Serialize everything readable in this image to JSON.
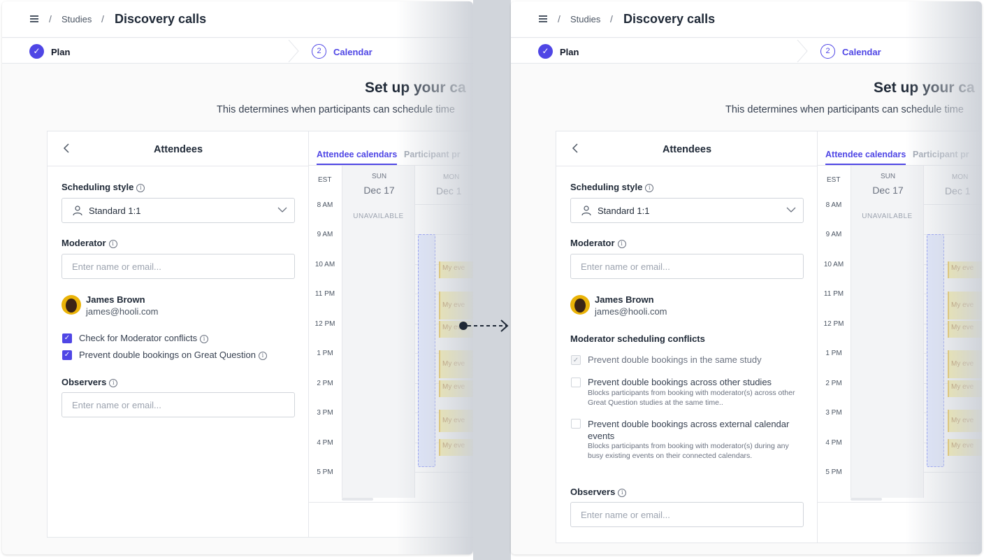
{
  "breadcrumb": {
    "separator": "/",
    "studies": "Studies",
    "title": "Discovery calls"
  },
  "stepper": {
    "step1_label": "Plan",
    "step1_check": "✓",
    "step2_num": "2",
    "step2_label": "Calendar"
  },
  "header": {
    "title": "Set up your ca",
    "subtitle": "This determines when participants can schedule time"
  },
  "attendees": {
    "title": "Attendees",
    "scheduling_style_label": "Scheduling style",
    "scheduling_style_value": "Standard 1:1",
    "moderator_label": "Moderator",
    "moderator_placeholder": "Enter name or email...",
    "moderator": {
      "name": "James Brown",
      "email": "james@hooli.com"
    },
    "observers_label": "Observers",
    "observers_placeholder": "Enter name or email...",
    "info_glyph": "i"
  },
  "left_options": [
    {
      "label": "Check for Moderator conflicts",
      "checked": true
    },
    {
      "label": "Prevent double bookings on Great Question",
      "checked": true
    }
  ],
  "right_conflicts": {
    "title": "Moderator scheduling conflicts",
    "options": [
      {
        "label": "Prevent double bookings in the same study",
        "checked": true,
        "disabled": true
      },
      {
        "label": "Prevent double bookings across other studies",
        "desc": "Blocks participants from booking with moderator(s) across other Great Question studies at the same time..",
        "checked": false
      },
      {
        "label": "Prevent double bookings across external calendar events",
        "desc": "Blocks participants from booking with moderator(s) during any busy existing events on their connected calendars.",
        "checked": false
      }
    ]
  },
  "calendar": {
    "tab_active": "Attendee calendars",
    "tab_other": "Participant pr",
    "timezone": "EST",
    "times": [
      "8 AM",
      "9 AM",
      "10 AM",
      "11 PM",
      "12 PM",
      "1 PM",
      "2 PM",
      "3 PM",
      "4 PM",
      "5 PM"
    ],
    "sun": {
      "dow": "SUN",
      "date": "Dec 17",
      "status": "UNAVAILABLE"
    },
    "mon": {
      "dow": "MON",
      "date": "Dec 1"
    },
    "event_label": "My eve"
  },
  "colors": {
    "accent": "#4f46e5",
    "event": "#fef08a",
    "connector": "#1f2937"
  }
}
